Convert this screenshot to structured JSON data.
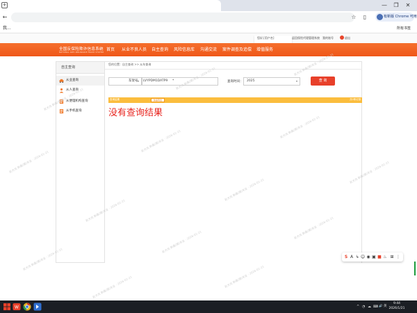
{
  "browser": {
    "tab_icon": "+",
    "back_glyph": "←",
    "forward_glyph": "",
    "profile_label": "有新版 Chrome 可用",
    "bookmark_left": "我...",
    "bookmark_right": "所有书签",
    "win_min": "—",
    "win_max": "❐",
    "win_close": "✕"
  },
  "site": {
    "top_links": [
      "您好,[用户名]",
      "返回保险代理管理系统",
      "我的账号",
      "退出"
    ],
    "logo_cn": "全国反保险欺诈信息系统",
    "logo_en": "NATIONAL ANTI-INSURANCE FRAUD SYSTEM",
    "nav": [
      "首页",
      "从业不良人员",
      "自主查询",
      "风险信息库",
      "沟通交流",
      "案件调查及追偿",
      "增值服务"
    ]
  },
  "sidebar": {
    "header": "自主查询",
    "items": [
      {
        "label": "从业查询",
        "icon": "car-icon",
        "active": true
      },
      {
        "label": "从人查询",
        "icon": "person-icon",
        "active": false
      },
      {
        "label": "从便理机构查询",
        "icon": "doc-icon",
        "active": false
      },
      {
        "label": "从手机查询",
        "icon": "doc-icon",
        "active": false
      }
    ]
  },
  "main": {
    "breadcrumb": "您的位置：自主查询 >> 从车查询",
    "filter_type": "车架号",
    "filter_value": "LVYPDM1DATP9",
    "filter_suffix": "*",
    "date_label": "查询时间：",
    "year_value": "2025",
    "query_button": "查 询",
    "result_left": "查询结果",
    "result_pill": "快速导出",
    "result_right": "共0条记录",
    "no_result": "没有查询结果"
  },
  "watermark": "赵大龙  新鑫(赣)车业 · 2026-01-21",
  "float_toolbar": [
    "S",
    "A",
    "↳",
    "☺",
    "◉",
    "▣",
    "■",
    "♨",
    "⊞",
    "⋮"
  ],
  "taskbar": {
    "time": "9:44",
    "date": "2026/1/21",
    "tray_icons": [
      "^",
      "◔",
      "☁",
      "⌨",
      "🔊",
      "英"
    ]
  },
  "colors": {
    "nav_orange": "#f0601f",
    "result_bar": "#fbbd3d",
    "query_red": "#e8402a",
    "no_result_red": "#e8251f"
  }
}
